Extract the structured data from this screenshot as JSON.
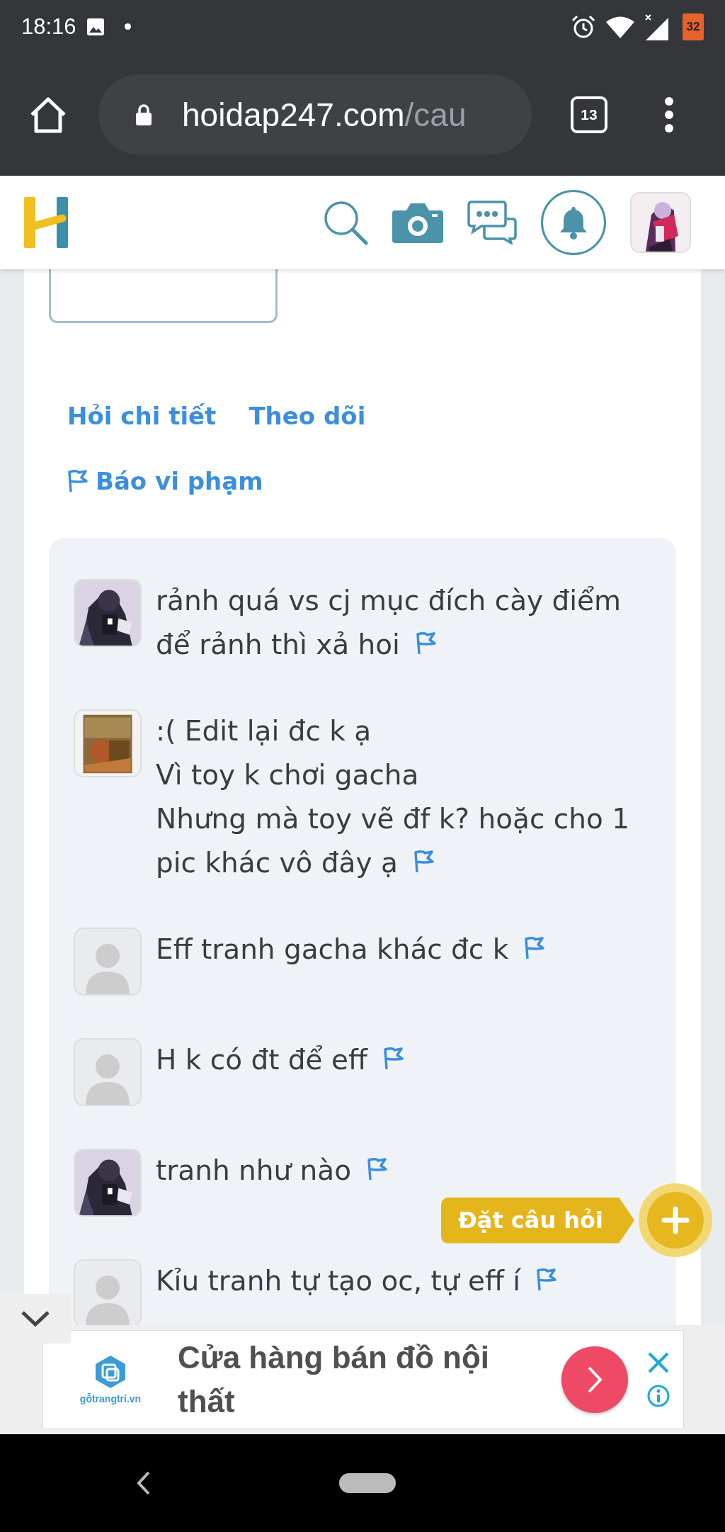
{
  "status_bar": {
    "time": "18:16",
    "battery": "32"
  },
  "browser": {
    "url_host": "hoidap247.com",
    "url_path": "/cau",
    "tab_count": "13"
  },
  "actions": [
    {
      "label": "Hỏi chi tiết"
    },
    {
      "label": "Theo dõi"
    }
  ],
  "report": {
    "label": "Báo vi phạm"
  },
  "comments": [
    {
      "kind": "picture",
      "text": "rảnh quá vs cj mục đích cày điểm\nđể rảnh thì xả hoi"
    },
    {
      "kind": "picture",
      "text": ":( Edit lại đc k ạ\nVì toy k chơi gacha\nNhưng mà toy vẽ đf k? hoặc cho 1\npic khác vô đây ạ"
    },
    {
      "kind": "placeholder",
      "text": "Eff tranh gacha khác đc k"
    },
    {
      "kind": "placeholder",
      "text": "H k có đt để eff"
    },
    {
      "kind": "picture",
      "text": "tranh như nào"
    },
    {
      "kind": "placeholder",
      "text": "Kỉu tranh tự tạo oc, tự eff í"
    }
  ],
  "ask_button": {
    "label": "Đặt câu hỏi"
  },
  "ad": {
    "brand": "gỗtrangtrí.vn",
    "headline": "Cửa hàng bán đồ nội thất"
  }
}
